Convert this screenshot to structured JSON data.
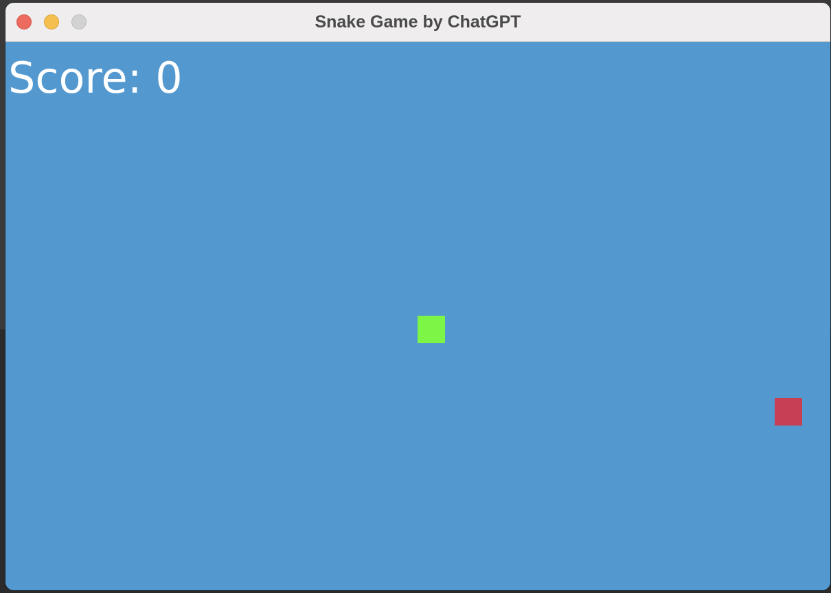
{
  "window": {
    "title": "Snake Game by ChatGPT"
  },
  "game": {
    "score_text": "Score: 0",
    "score": 0,
    "background_color": "#5398cf",
    "snake_color": "#7cf547",
    "food_color": "#c73f55"
  }
}
